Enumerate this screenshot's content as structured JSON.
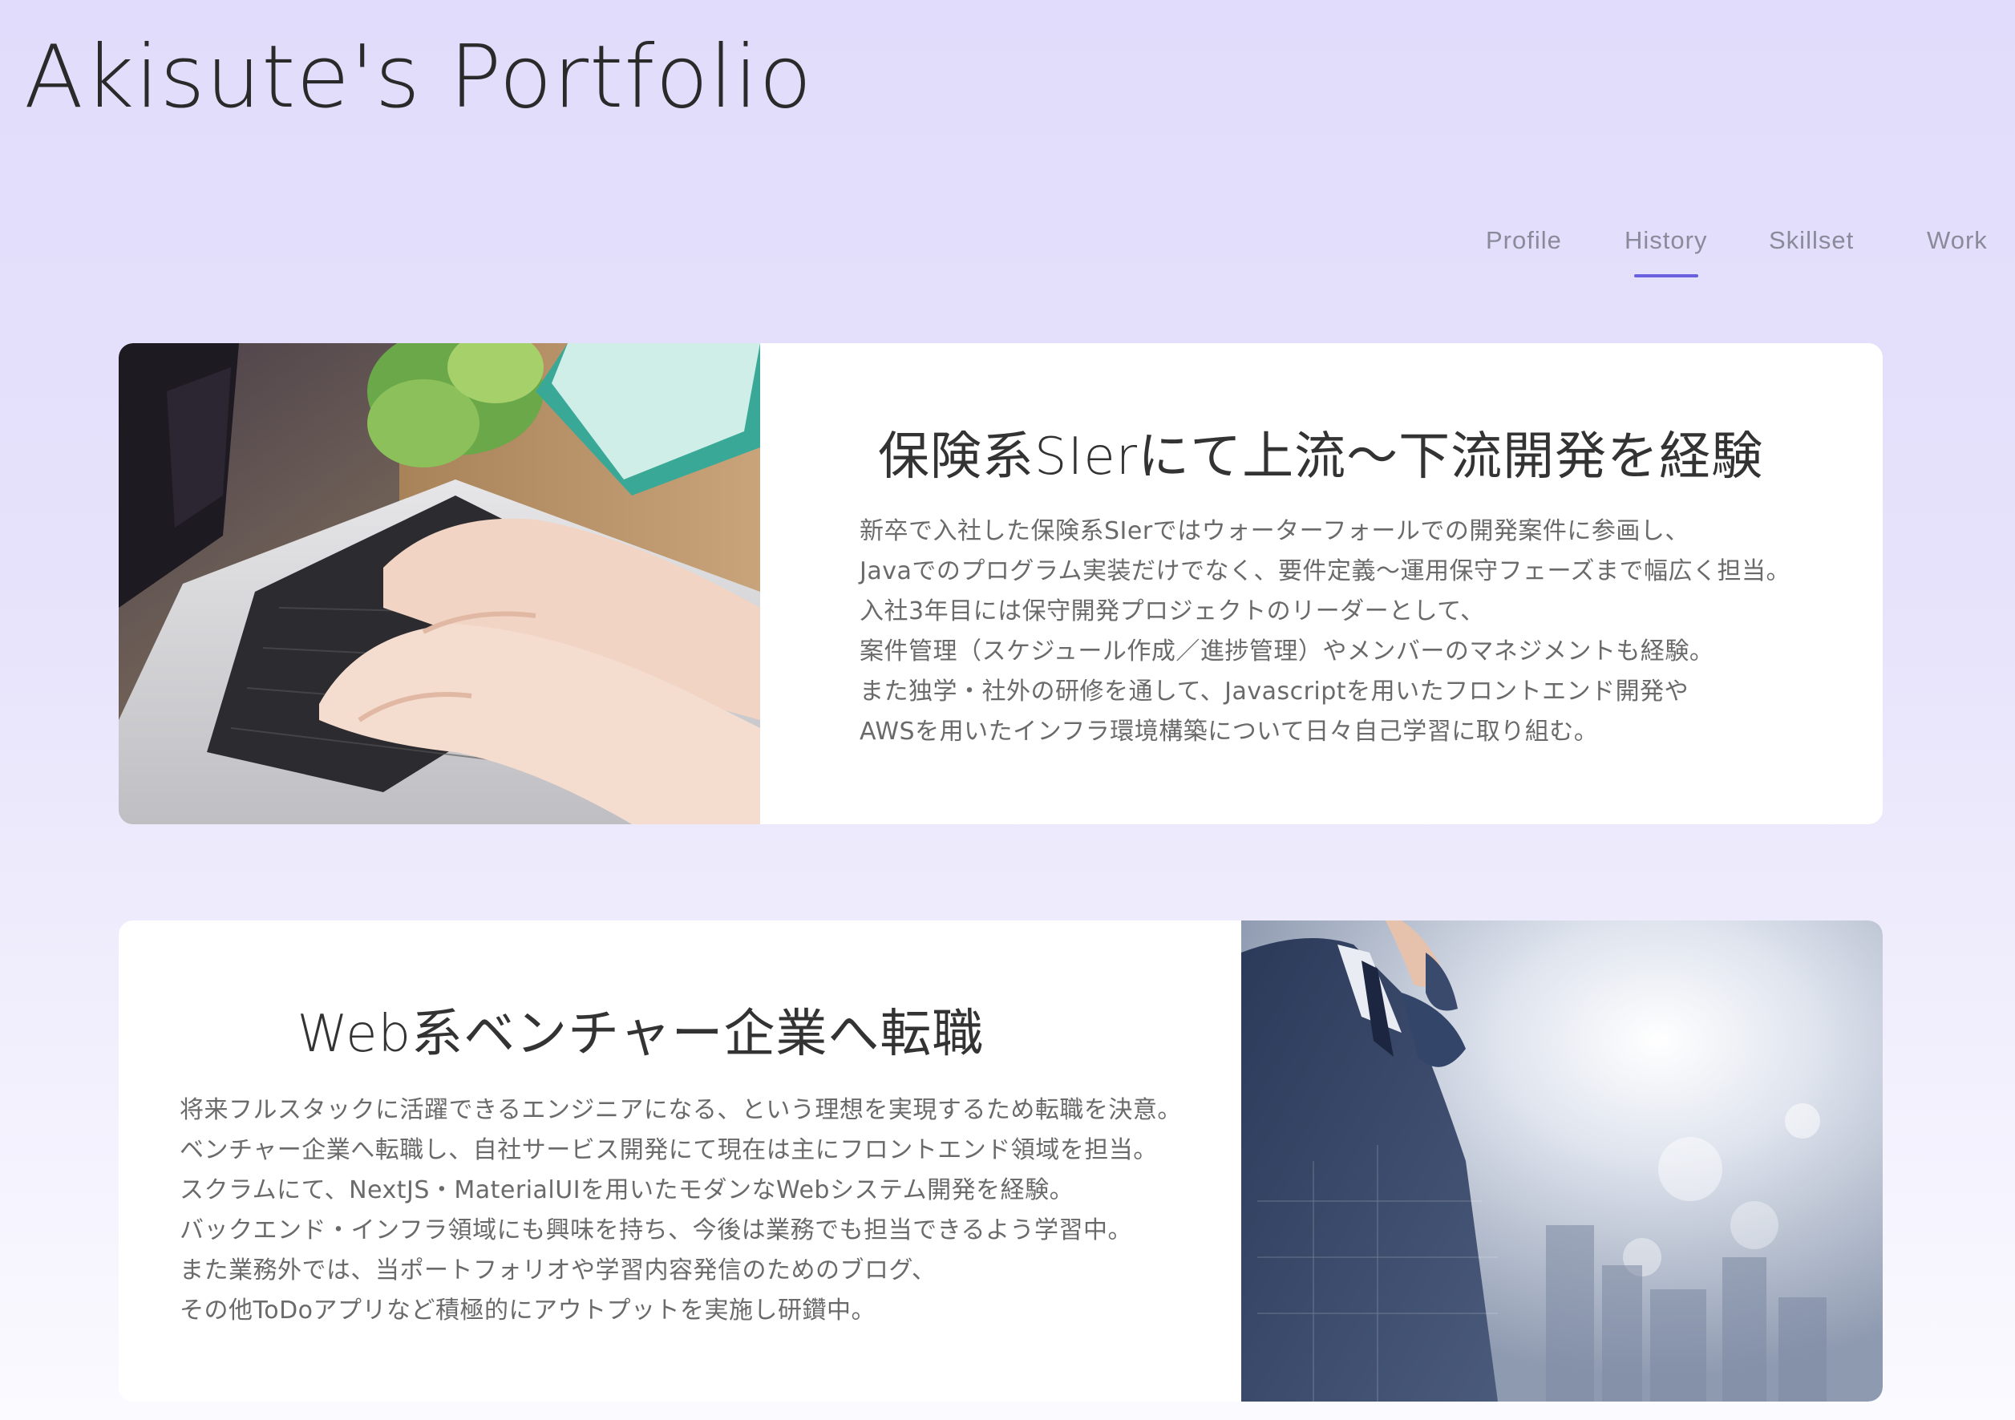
{
  "header": {
    "title": "Akisute's Portfolio"
  },
  "nav": {
    "items": [
      {
        "label": "Profile"
      },
      {
        "label": "History"
      },
      {
        "label": "Skillset"
      },
      {
        "label": "Work"
      }
    ],
    "active": "History",
    "accent_color": "#6a5fdc"
  },
  "history": [
    {
      "title": "保険系SIerにて上流〜下流開発を経験",
      "image": "laptop-typing-photo",
      "lines": [
        "新卒で入社した保険系SIerではウォーターフォールでの開発案件に参画し、",
        "Javaでのプログラム実装だけでなく、要件定義〜運用保守フェーズまで幅広く担当。",
        "入社3年目には保守開発プロジェクトのリーダーとして、",
        "案件管理（スケジュール作成／進捗管理）やメンバーのマネジメントも経験。",
        "また独学・社外の研修を通して、Javascriptを用いたフロントエンド開発や",
        "AWSを用いたインフラ環境構築について日々自己学習に取り組む。"
      ]
    },
    {
      "title": "Web系ベンチャー企業へ転職",
      "image": "businessman-city-photo",
      "lines": [
        "将来フルスタックに活躍できるエンジニアになる、という理想を実現するため転職を決意。",
        "ベンチャー企業へ転職し、自社サービス開発にて現在は主にフロントエンド領域を担当。",
        "スクラムにて、NextJS・MaterialUIを用いたモダンなWebシステム開発を経験。",
        "バックエンド・インフラ領域にも興味を持ち、今後は業務でも担当できるよう学習中。",
        "また業務外では、当ポートフォリオや学習内容発信のためのブログ、",
        "その他ToDoアプリなど積極的にアウトプットを実施し研鑽中。"
      ]
    }
  ]
}
